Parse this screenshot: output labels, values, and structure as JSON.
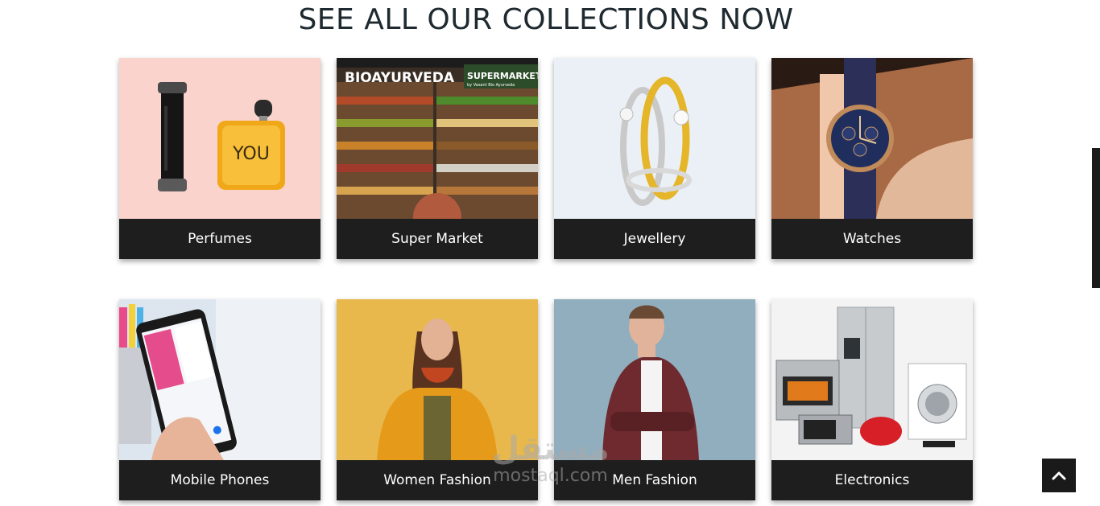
{
  "page": {
    "title": "SEE ALL OUR COLLECTIONS NOW"
  },
  "collections": [
    {
      "label": "Perfumes",
      "image": "perfume-bottles-image"
    },
    {
      "label": "Super Market",
      "image": "supermarket-shelves-image",
      "image_text": {
        "brand": "BIOAYURVEDA",
        "sign": "SUPERMARKET",
        "sign_sub": "by Vasant Bio Ayurveda"
      }
    },
    {
      "label": "Jewellery",
      "image": "gold-rings-image"
    },
    {
      "label": "Watches",
      "image": "wrist-watch-image"
    },
    {
      "label": "Mobile Phones",
      "image": "smartphone-in-hand-image"
    },
    {
      "label": "Women Fashion",
      "image": "woman-yellow-jacket-image"
    },
    {
      "label": "Men Fashion",
      "image": "man-maroon-jacket-image"
    },
    {
      "label": "Electronics",
      "image": "home-appliances-image"
    }
  ],
  "watermark": {
    "arabic": "مستقل",
    "latin": "mostaql.com"
  },
  "icons": {
    "back_to_top": "chevron-up-icon"
  },
  "colors": {
    "label_bg": "#1e1e1e",
    "label_text": "#ffffff",
    "title": "#1f2a30"
  }
}
